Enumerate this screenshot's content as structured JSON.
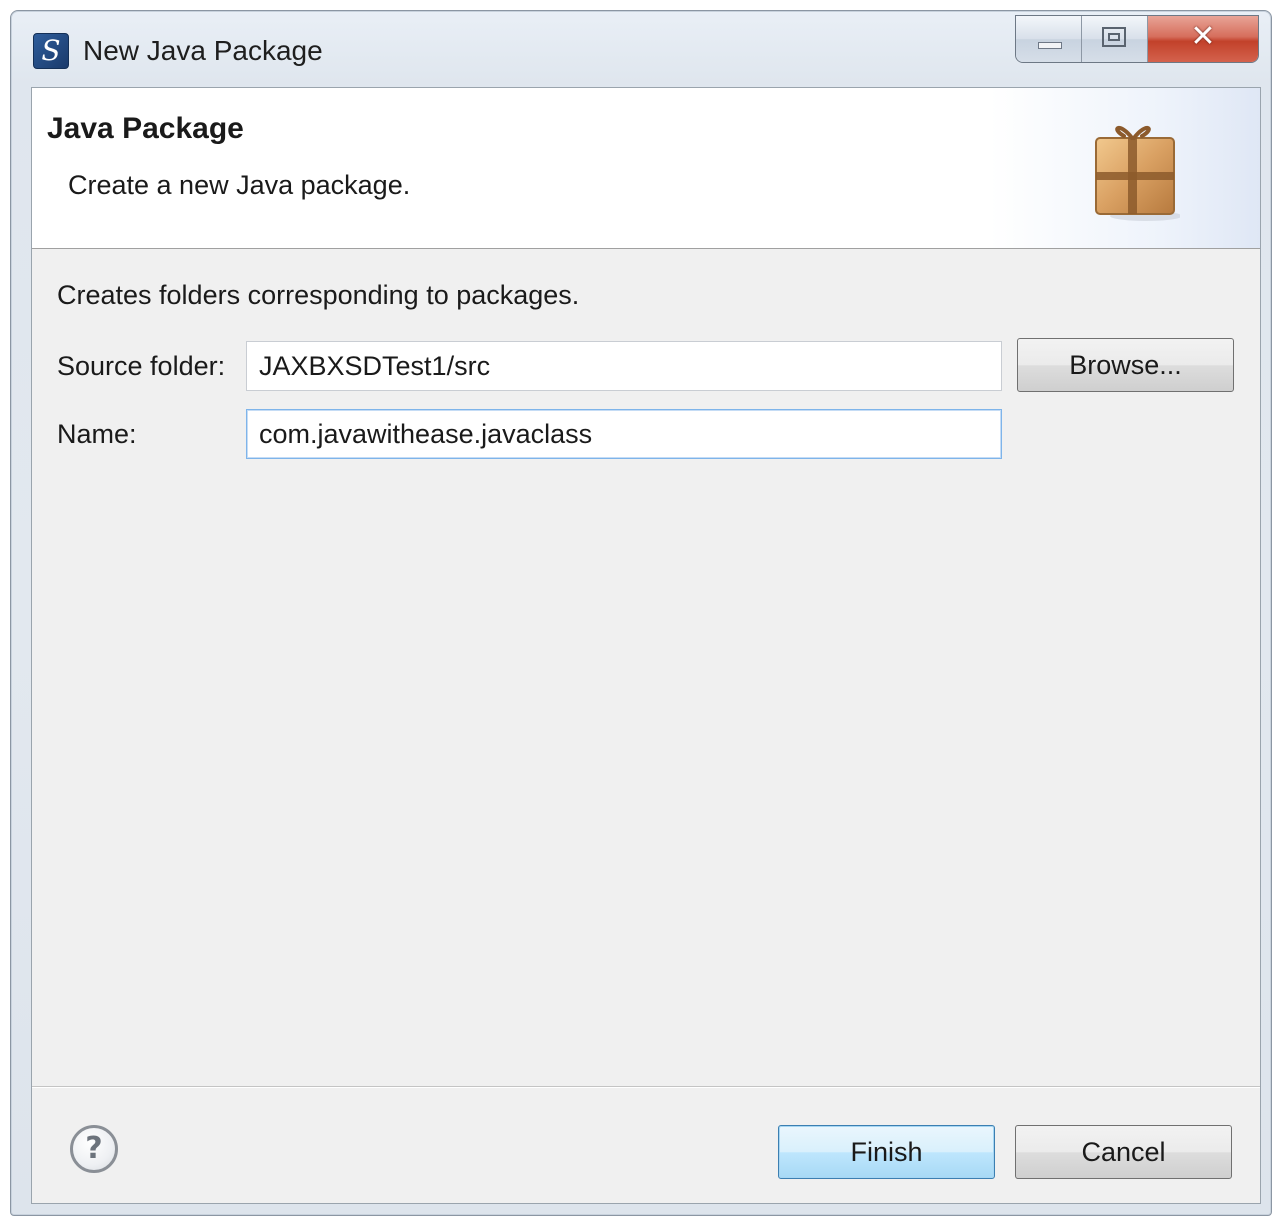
{
  "window": {
    "title": "New Java Package"
  },
  "banner": {
    "title": "Java Package",
    "description": "Create a new Java package."
  },
  "body": {
    "intro": "Creates folders corresponding to packages."
  },
  "fields": {
    "source_folder": {
      "label": "Source folder:",
      "value": "JAXBXSDTest1/src"
    },
    "name": {
      "label": "Name:",
      "value": "com.javawithease.javaclass"
    }
  },
  "buttons": {
    "browse": "Browse...",
    "finish": "Finish",
    "cancel": "Cancel",
    "help": "?"
  },
  "icons": {
    "app": "eclipse-app-icon",
    "package": "package-icon",
    "help": "help-icon"
  },
  "colors": {
    "default_button": "#bee6fd",
    "close_button": "#c2412a",
    "focus_border": "#7eb4ea"
  }
}
